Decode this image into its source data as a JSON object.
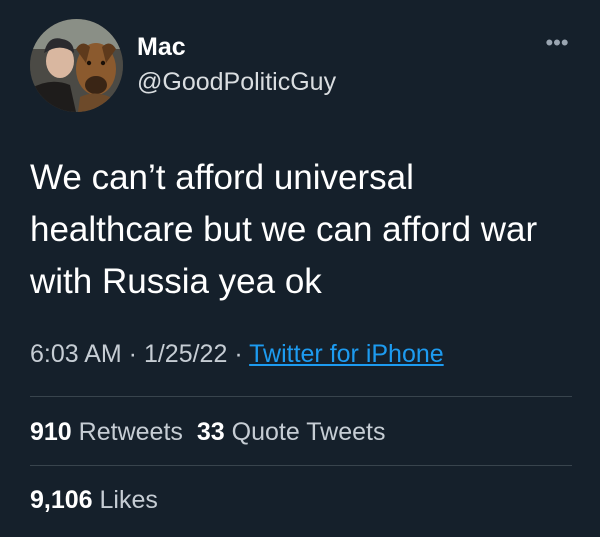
{
  "author": {
    "name": "Mac",
    "handle": "@GoodPoliticGuy"
  },
  "more_icon": "•••",
  "tweet": {
    "text": "We can’t afford universal\nhealthcare but we can afford war\nwith Russia yea ok"
  },
  "meta": {
    "time": "6:03 AM",
    "sep1": " · ",
    "date": "1/25/22",
    "sep2": " · ",
    "source": "Twitter for iPhone"
  },
  "stats": {
    "retweets_count": "910",
    "retweets_label": "Retweets",
    "quotes_count": "33",
    "quotes_label": "Quote Tweets",
    "likes_count": "9,106",
    "likes_label": "Likes"
  },
  "colors": {
    "background": "#15202b",
    "link": "#1d9bf0",
    "divider": "#38444d"
  }
}
